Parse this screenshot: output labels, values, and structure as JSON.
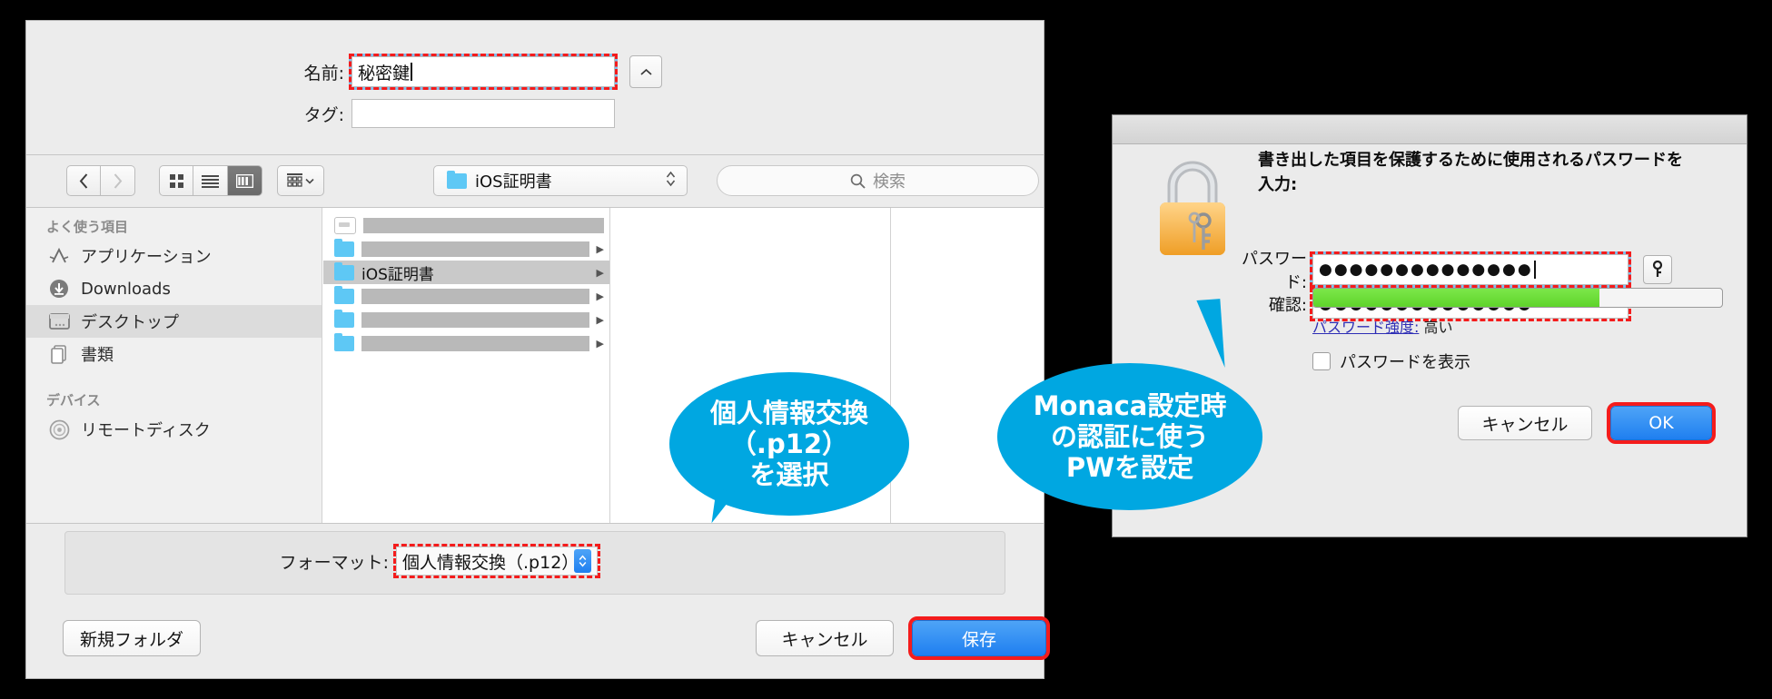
{
  "save_dialog": {
    "name_label": "名前:",
    "name_value": "秘密鍵",
    "tag_label": "タグ:",
    "tag_value": "",
    "stepper_icon": "chevron-up-icon",
    "toolbar": {
      "back_icon": "chevron-left-icon",
      "forward_icon": "chevron-right-icon",
      "view_icon_grid": "grid-view-icon",
      "view_icon_list": "list-view-icon",
      "view_icon_column": "column-view-icon",
      "arrange_icon": "arrange-icon",
      "arrange_caret": "chevron-down-icon",
      "location_icon": "folder-icon",
      "location_value": "iOS証明書",
      "location_stepper": "up-down-arrows-icon",
      "search_icon": "search-icon",
      "search_placeholder": "検索"
    },
    "sidebar": {
      "sections": [
        {
          "header": "よく使う項目",
          "items": [
            {
              "label": "アプリケーション",
              "icon": "applications-icon",
              "selected": false
            },
            {
              "label": "Downloads",
              "icon": "downloads-icon",
              "selected": false
            },
            {
              "label": "デスクトップ",
              "icon": "desktop-icon",
              "selected": true
            },
            {
              "label": "書類",
              "icon": "documents-icon",
              "selected": false
            }
          ]
        },
        {
          "header": "デバイス",
          "items": [
            {
              "label": "リモートディスク",
              "icon": "disc-icon",
              "selected": false
            }
          ]
        }
      ]
    },
    "file_column": {
      "rows": [
        {
          "name": "",
          "redacted": true,
          "icon": "file-icon",
          "has_disclosure": false,
          "selected": false
        },
        {
          "name": "",
          "redacted": true,
          "icon": "folder-icon",
          "has_disclosure": true,
          "selected": false
        },
        {
          "name": "iOS証明書",
          "redacted": false,
          "icon": "folder-icon",
          "has_disclosure": true,
          "selected": true
        },
        {
          "name": "",
          "redacted": true,
          "icon": "folder-icon",
          "has_disclosure": true,
          "selected": false
        },
        {
          "name": "",
          "redacted": true,
          "icon": "folder-icon",
          "has_disclosure": true,
          "selected": false
        },
        {
          "name": "",
          "redacted": true,
          "icon": "folder-icon",
          "has_disclosure": true,
          "selected": false
        }
      ]
    },
    "format_label": "フォーマット:",
    "format_value": "個人情報交換（.p12）",
    "format_stepper": "up-down-arrows-icon",
    "new_folder_button": "新規フォルダ",
    "cancel_button": "キャンセル",
    "save_button": "保存"
  },
  "password_dialog": {
    "lock_icon": "lock-with-keys-icon",
    "message": "書き出した項目を保護するために使用されるパスワードを入力:",
    "password_label": "パスワード:",
    "password_value": "●●●●●●●●●●●●●●",
    "confirm_label": "確認:",
    "confirm_value": "●●●●●●●●●●●●●●",
    "key_button_icon": "key-icon",
    "strength_percent": 70,
    "strength_link": "パスワード強度:",
    "strength_value": "高い",
    "show_password_label": "パスワードを表示",
    "show_password_checked": false,
    "cancel_button": "キャンセル",
    "ok_button": "OK"
  },
  "callouts": [
    {
      "lines": [
        "個人情報交換",
        "（.p12）",
        "を選択"
      ]
    },
    {
      "lines": [
        "Monaca設定時",
        "の認証に使う",
        "PWを設定"
      ]
    }
  ],
  "colors": {
    "callout_blue": "#00a7e1",
    "highlight_red": "#f41c1c",
    "primary_button_blue": "#2d89f0",
    "strength_green": "#5fd32b",
    "focus_blue": "#7fc0ee"
  }
}
